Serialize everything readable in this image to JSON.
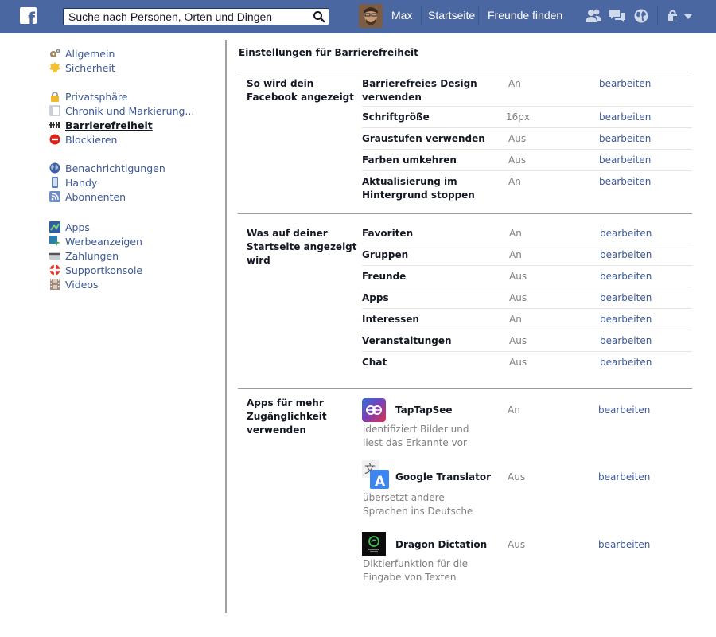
{
  "topbar": {
    "logo": "f",
    "search_placeholder": "Suche nach Personen, Orten und Dingen",
    "user_name": "Max",
    "nav_home": "Startseite",
    "nav_find_friends": "Freunde finden",
    "bar_color": "#4b67a1"
  },
  "sidebar": {
    "items": [
      {
        "label": "Allgemein",
        "icon": "gears-icon"
      },
      {
        "label": "Sicherheit",
        "icon": "security-badge-icon"
      },
      {
        "label": "Privatsphäre",
        "icon": "lock-icon"
      },
      {
        "label": "Chronik und Markierung...",
        "icon": "timeline-icon"
      },
      {
        "label": "Barrierefreiheit",
        "icon": "accessibility-icon",
        "active": true
      },
      {
        "label": "Blockieren",
        "icon": "block-icon"
      },
      {
        "label": "Benachrichtigungen",
        "icon": "globe-icon"
      },
      {
        "label": "Handy",
        "icon": "mobile-icon"
      },
      {
        "label": "Abonnenten",
        "icon": "rss-icon"
      },
      {
        "label": "Apps",
        "icon": "apps-icon"
      },
      {
        "label": "Werbeanzeigen",
        "icon": "ads-icon"
      },
      {
        "label": "Zahlungen",
        "icon": "credit-card-icon"
      },
      {
        "label": "Supportkonsole",
        "icon": "lifebuoy-icon"
      },
      {
        "label": "Videos",
        "icon": "film-icon"
      }
    ]
  },
  "main": {
    "title": "Einstellungen für Barrierefreiheit",
    "edit_label": "bearbeiten",
    "sections": [
      {
        "label": "So wird dein Facebook angezeigt",
        "rows": [
          {
            "name": "Barrierefreies Design verwenden",
            "value": "An"
          },
          {
            "name": "Schriftgröße",
            "value": "16px"
          },
          {
            "name": "Graustufen verwenden",
            "value": "Aus"
          },
          {
            "name": "Farben umkehren",
            "value": "Aus"
          },
          {
            "name": "Aktualisierung im Hintergrund stoppen",
            "value": "An"
          }
        ]
      },
      {
        "label": "Was auf deiner Startseite angezeigt wird",
        "rows": [
          {
            "name": "Favoriten",
            "value": "An"
          },
          {
            "name": "Gruppen",
            "value": "An"
          },
          {
            "name": "Freunde",
            "value": "Aus"
          },
          {
            "name": "Apps",
            "value": "Aus"
          },
          {
            "name": "Interessen",
            "value": "An"
          },
          {
            "name": "Veranstaltungen",
            "value": "Aus"
          },
          {
            "name": "Chat",
            "value": "Aus"
          }
        ]
      },
      {
        "label": "Apps für mehr Zugänglichkeit verwenden",
        "apps": [
          {
            "name": "TapTapSee",
            "value": "An",
            "description": "identifiziert Bilder und liest das Erkannte vor",
            "icon": "taptapsee-icon"
          },
          {
            "name": "Google Translator",
            "value": "Aus",
            "description": "übersetzt andere Sprachen ins Deutsche",
            "icon": "translate-icon"
          },
          {
            "name": "Dragon Dictation",
            "value": "Aus",
            "description": "Diktierfunktion für die Eingabe von Texten",
            "icon": "dragon-icon"
          }
        ]
      }
    ]
  }
}
